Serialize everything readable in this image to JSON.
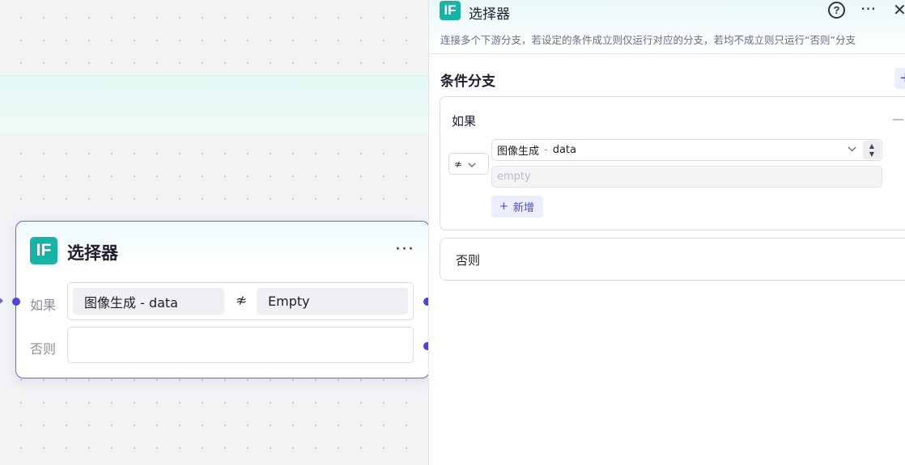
{
  "canvas": {
    "node": {
      "icon_text": "IF",
      "title": "选择器",
      "more": "···",
      "if_label": "如果",
      "else_label": "否则",
      "condition": {
        "variable": "图像生成  -  data",
        "operator": "≉",
        "value": "Empty"
      }
    }
  },
  "panel": {
    "icon_text": "IF",
    "title": "选择器",
    "help": "?",
    "more": "···",
    "close": "✕",
    "description": "连接多个下游分支，若设定的条件成立则仅运行对应的分支，若均不成立则只运行“否则”分支",
    "section_title": "条件分支",
    "add_branch": "+",
    "if_card": {
      "label": "如果",
      "collapse": "—",
      "operator": "≉",
      "variable_source": "图像生成",
      "variable_sep": "-",
      "variable_name": "data",
      "value_placeholder": "empty",
      "add_condition": "新增",
      "add_condition_icon": "+"
    },
    "else_card": {
      "label": "否则"
    }
  },
  "colors": {
    "accent": "#4b46d6",
    "node_border": "#6a63e8",
    "icon_teal": "#19b2a7"
  }
}
